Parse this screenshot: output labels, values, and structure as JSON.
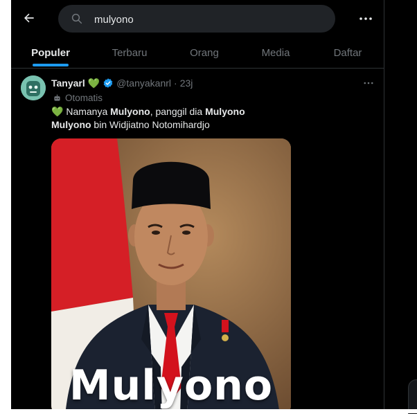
{
  "search": {
    "query": "mulyono"
  },
  "tabs": [
    {
      "label": "Populer",
      "active": true
    },
    {
      "label": "Terbaru",
      "active": false
    },
    {
      "label": "Orang",
      "active": false
    },
    {
      "label": "Media",
      "active": false
    },
    {
      "label": "Daftar",
      "active": false
    }
  ],
  "post": {
    "display_name": "Tanyarl",
    "heart": "💚",
    "handle": "@tanyakanrl",
    "separator": "·",
    "time": "23j",
    "automated_label": "Otomatis",
    "text_line1": {
      "heart": "💚",
      "t1": " Namanya ",
      "b1": "Mulyono",
      "t2": ", panggil dia ",
      "b2": "Mulyono"
    },
    "text_line2": {
      "b1": "Mulyono",
      "t1": " bin Widjiatno Notomihardjo"
    },
    "media": {
      "caption": "Mulyono"
    }
  },
  "colors": {
    "background": "#000000",
    "accent": "#1d9bf0",
    "text": "#e7e9ea",
    "muted": "#71767b"
  },
  "icons": [
    "back-arrow-icon",
    "search-icon",
    "more-icon",
    "verified-badge-icon",
    "robot-icon"
  ]
}
